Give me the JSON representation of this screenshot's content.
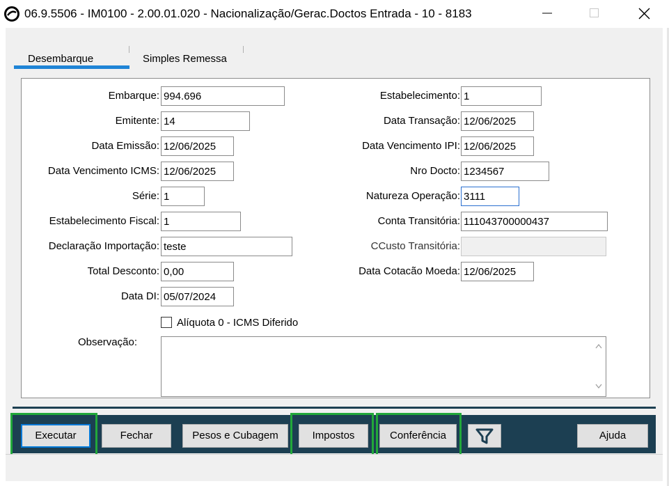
{
  "window": {
    "title": "06.9.5506 - IM0100 - 2.00.01.020 - Nacionalização/Gerac.Doctos Entrada - 10 - 8183",
    "minimize_icon": "minimize-icon",
    "maximize_icon": "maximize-icon",
    "close_icon": "close-icon"
  },
  "tabs": [
    {
      "label": "Desembarque",
      "active": true
    },
    {
      "label": "Simples Remessa",
      "active": false
    }
  ],
  "form": {
    "embarque": {
      "label": "Embarque:",
      "value": "994.696"
    },
    "emitente": {
      "label": "Emitente:",
      "value": "14"
    },
    "data_emissao": {
      "label": "Data Emissão:",
      "value": "12/06/2025"
    },
    "data_venc_icms": {
      "label": "Data Vencimento ICMS:",
      "value": "12/06/2025"
    },
    "serie": {
      "label": "Série:",
      "value": "1"
    },
    "estab_fiscal": {
      "label": "Estabelecimento Fiscal:",
      "value": "1"
    },
    "decl_importacao": {
      "label": "Declaração Importação:",
      "value": "teste"
    },
    "total_desconto": {
      "label": "Total Desconto:",
      "value": "0,00"
    },
    "data_di": {
      "label": "Data DI:",
      "value": "05/07/2024"
    },
    "estabelecimento": {
      "label": "Estabelecimento:",
      "value": "1"
    },
    "data_transacao": {
      "label": "Data Transação:",
      "value": "12/06/2025"
    },
    "data_venc_ipi": {
      "label": "Data Vencimento IPI:",
      "value": "12/06/2025"
    },
    "nro_docto": {
      "label": "Nro Docto:",
      "value": "1234567"
    },
    "natureza_operacao": {
      "label": "Natureza Operação:",
      "value": "3111"
    },
    "conta_transitoria": {
      "label": "Conta Transitória:",
      "value": "11104370000043​7"
    },
    "ccusto_transitoria": {
      "label": "CCusto Transitória:",
      "value": ""
    },
    "data_cotacao": {
      "label": "Data Cotacão Moeda:",
      "value": "12/06/2025"
    },
    "aliquota_checkbox": {
      "label": "Alíquota 0 - ICMS Diferido",
      "checked": false
    },
    "observacao": {
      "label": "Observação:",
      "value": ""
    }
  },
  "buttons": {
    "executar": "Executar",
    "fechar": "Fechar",
    "pesos": "Pesos e Cubagem",
    "impostos": "Impostos",
    "conferencia": "Conferência",
    "filter_icon": "filter-icon",
    "ajuda": "Ajuda"
  },
  "colors": {
    "toolbar_bg": "#1c3f52",
    "tab_accent": "#1f84d6",
    "highlight": "#22a83a"
  }
}
